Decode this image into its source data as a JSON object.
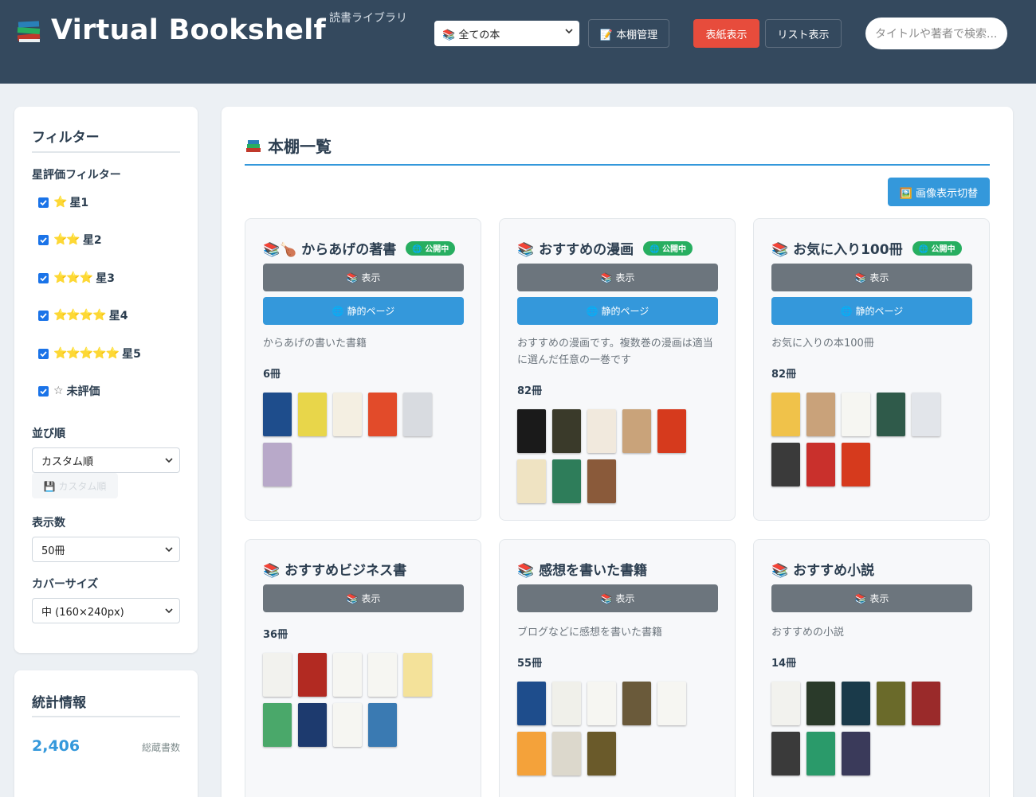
{
  "header": {
    "logo": "Virtual Bookshelf",
    "subtitle": "読書ライブラリ",
    "shelf_select": "📚 全ての本",
    "manage_label": "📝 本棚管理",
    "cover_view_label": "表紙表示",
    "list_view_label": "リスト表示",
    "search_placeholder": "タイトルや著者で検索..."
  },
  "sidebar": {
    "filter_title": "フィルター",
    "rating_label": "星評価フィルター",
    "ratings": [
      {
        "stars": "⭐",
        "label": "星1"
      },
      {
        "stars": "⭐⭐",
        "label": "星2"
      },
      {
        "stars": "⭐⭐⭐",
        "label": "星3"
      },
      {
        "stars": "⭐⭐⭐⭐",
        "label": "星4"
      },
      {
        "stars": "⭐⭐⭐⭐⭐",
        "label": "星5"
      },
      {
        "stars": "☆",
        "label": "未評価"
      }
    ],
    "sort_label": "並び順",
    "sort_value": "カスタム順",
    "custom_sort_button": "💾 カスタム順",
    "count_label": "表示数",
    "count_value": "50冊",
    "cover_size_label": "カバーサイズ",
    "cover_size_value": "中 (160×240px)",
    "stats_title": "統計情報",
    "total_books": "2,406",
    "total_books_label": "総蔵書数"
  },
  "main": {
    "title": "本棚一覧",
    "toggle_images": "🖼️ 画像表示切替",
    "cards": [
      {
        "title": "📚🍗 からあげの著書",
        "badge": "🌐 公開中",
        "view": "📚 表示",
        "static": "🌐 静的ページ",
        "desc": "からあげの書いた書籍",
        "count": "6冊",
        "covers": [
          "#1e4d8c",
          "#e8d64a",
          "#f4efe2",
          "#e24b2a",
          "#d8dbe0",
          "#b8a9c9"
        ]
      },
      {
        "title": "📚 おすすめの漫画",
        "badge": "🌐 公開中",
        "view": "📚 表示",
        "static": "🌐 静的ページ",
        "desc": "おすすめの漫画です。複数巻の漫画は適当に選んだ任意の一巻です",
        "count": "82冊",
        "covers": [
          "#1a1a1a",
          "#3a3a2a",
          "#f1e9dd",
          "#c9a37a",
          "#d63a1d",
          "#efe3c2",
          "#2e7d5a",
          "#8a5a3a"
        ]
      },
      {
        "title": "📚 お気に入り100冊",
        "badge": "🌐 公開中",
        "view": "📚 表示",
        "static": "🌐 静的ページ",
        "desc": "お気に入りの本100冊",
        "count": "82冊",
        "covers": [
          "#f0c24a",
          "#c9a27a",
          "#f6f6f2",
          "#2f5a4a",
          "#e2e5ea",
          "#3a3a3a",
          "#c9302c",
          "#d63a1d"
        ]
      },
      {
        "title": "📚 おすすめビジネス書",
        "view": "📚 表示",
        "count": "36冊",
        "covers": [
          "#f2f2ee",
          "#b22a22",
          "#f6f6f2",
          "#f6f6f2",
          "#f4e29a",
          "#4aa86a",
          "#1d3a6e",
          "#f6f6f2",
          "#3a7ab2"
        ]
      },
      {
        "title": "📚 感想を書いた書籍",
        "view": "📚 表示",
        "desc": "ブログなどに感想を書いた書籍",
        "count": "55冊",
        "covers": [
          "#1e4d8c",
          "#f0f0ea",
          "#f6f6f2",
          "#6a5a3a",
          "#f6f6f2",
          "#f4a23a",
          "#dcd8cc",
          "#6a5a2a"
        ]
      },
      {
        "title": "📚 おすすめ小説",
        "view": "📚 表示",
        "desc": "おすすめの小説",
        "count": "14冊",
        "covers": [
          "#f2f2ee",
          "#2a3a2a",
          "#1a3a4a",
          "#6a6a2a",
          "#9a2a2a",
          "#3a3a3a",
          "#2a9a6a",
          "#3a3a5a"
        ]
      }
    ]
  }
}
